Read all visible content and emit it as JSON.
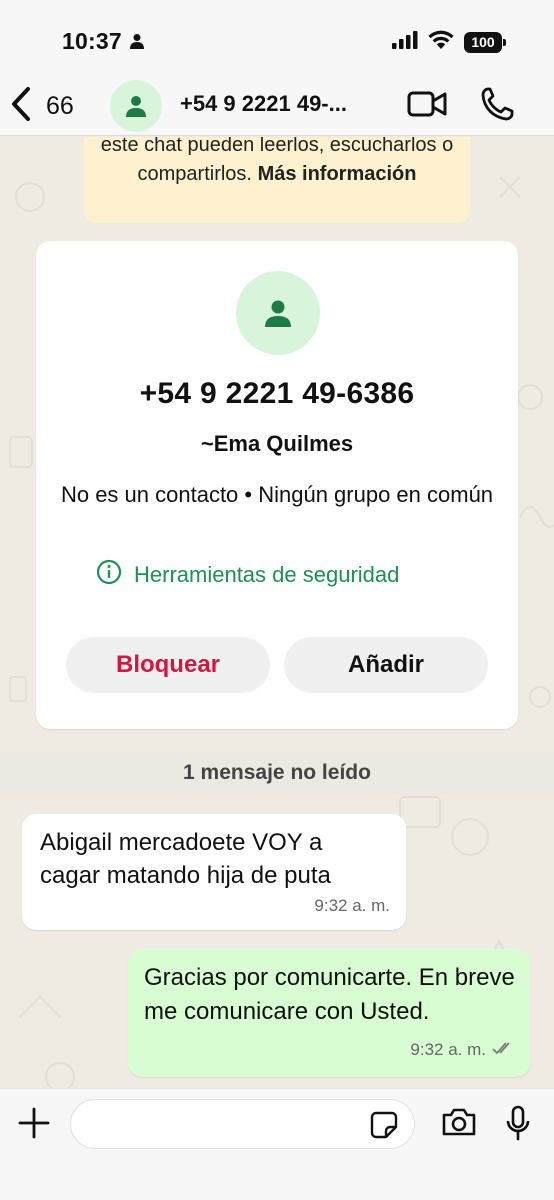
{
  "status_bar": {
    "time": "10:37",
    "battery": "100"
  },
  "header": {
    "back_count": "66",
    "title": "+54 9 2221 49-..."
  },
  "encryption_notice": {
    "text": "este chat pueden leerlos, escucharlos o compartirlos.",
    "more_link": "Más información"
  },
  "contact_card": {
    "phone": "+54 9 2221 49-6386",
    "name": "~Ema Quilmes",
    "info": "No es un contacto • Ningún grupo en común",
    "safety_tools": "Herramientas de seguridad",
    "block_label": "Bloquear",
    "add_label": "Añadir"
  },
  "unread_divider": "1 mensaje no leído",
  "messages": [
    {
      "direction": "incoming",
      "text": "Abigail mercadoete VOY a cagar matando hija de puta",
      "time": "9:32 a. m."
    },
    {
      "direction": "outgoing",
      "text": "Gracias por comunicarte. En breve me comunicare con Usted.",
      "time": "9:32 a. m."
    }
  ],
  "composer": {
    "placeholder": ""
  },
  "colors": {
    "accent_green": "#1f8f55",
    "block_red": "#d3173f",
    "outgoing_bubble": "#d9fdd3",
    "notice_bg": "#fdf1cf"
  }
}
